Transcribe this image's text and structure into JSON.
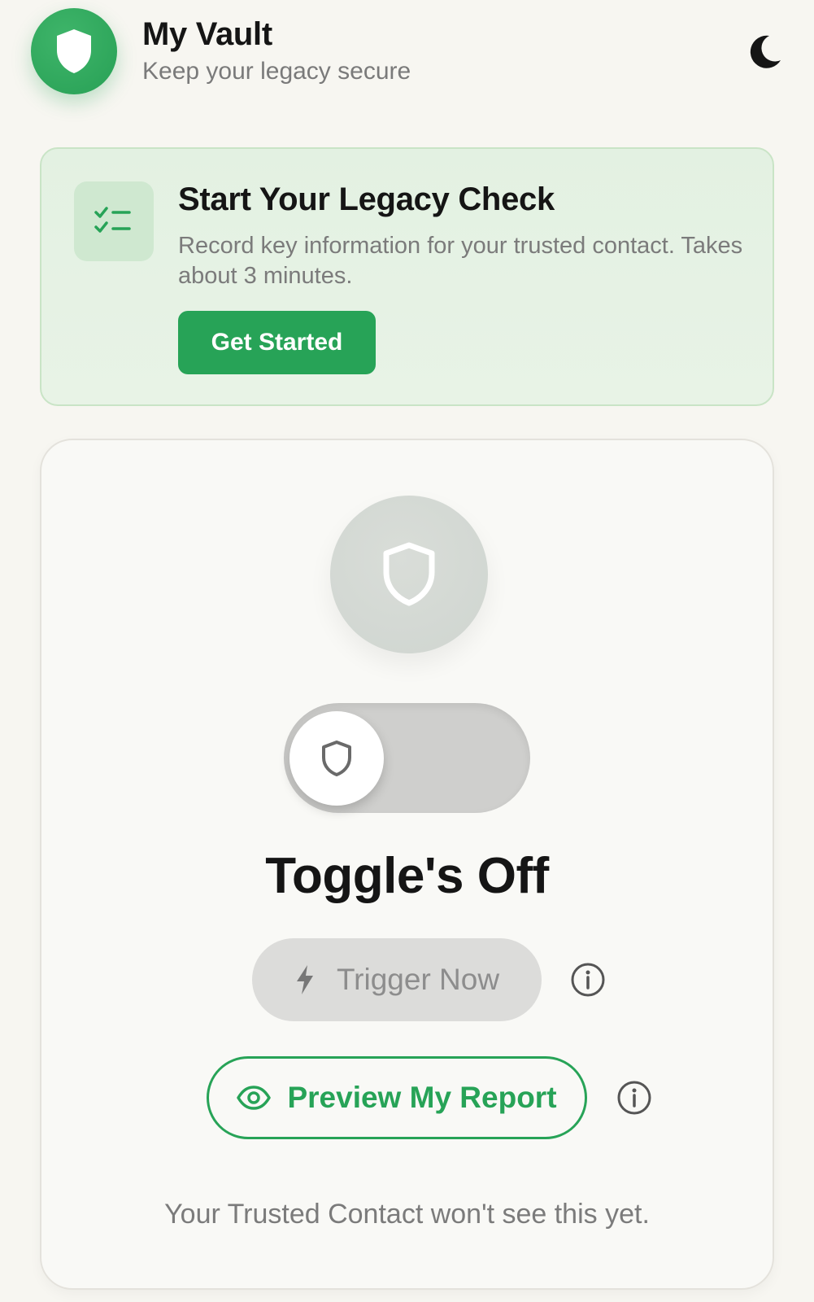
{
  "header": {
    "title": "My Vault",
    "subtitle": "Keep your legacy secure",
    "logo_icon": "shield-icon",
    "theme_icon": "moon-icon"
  },
  "legacy_check": {
    "icon": "checklist-icon",
    "title": "Start Your Legacy Check",
    "description": "Record key information for your trusted contact. Takes about 3 minutes.",
    "button_label": "Get Started"
  },
  "vault_card": {
    "status_icon": "shield-outline-icon",
    "toggle": {
      "on": false,
      "knob_icon": "shield-icon"
    },
    "status_text": "Toggle's Off",
    "trigger_button": {
      "label": "Trigger Now",
      "icon": "lightning-icon",
      "enabled": false
    },
    "preview_button": {
      "label": "Preview My Report",
      "icon": "eye-icon"
    },
    "info_icon": "info-icon",
    "footnote": "Your Trusted Contact won't see this yet."
  },
  "colors": {
    "brand_green": "#27a357",
    "background": "#f7f6f1",
    "card_tint": "#e3f1e2",
    "disabled_gray": "#dcdcda"
  }
}
